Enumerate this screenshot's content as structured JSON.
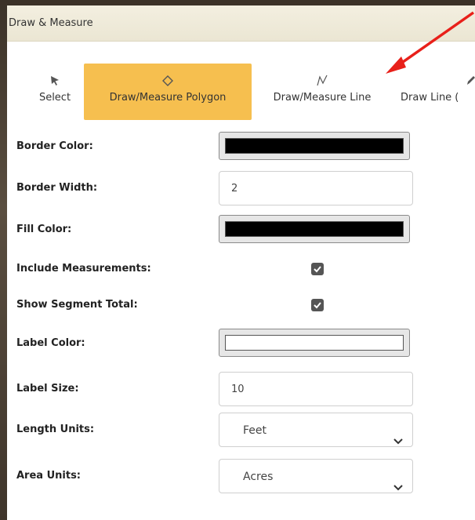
{
  "window": {
    "title": "Draw & Measure"
  },
  "toolbar": {
    "tools": [
      {
        "label": "Select",
        "icon": "select-arrow-icon"
      },
      {
        "label": "Draw/Measure Polygon",
        "icon": "polygon-icon",
        "active": true
      },
      {
        "label": "Draw/Measure Line",
        "icon": "polyline-icon"
      },
      {
        "label": "Draw Line (",
        "icon": "pencil-icon"
      }
    ]
  },
  "form": {
    "border_color": {
      "label": "Border Color:",
      "value": "#000000"
    },
    "border_width": {
      "label": "Border Width:",
      "value": "2"
    },
    "fill_color": {
      "label": "Fill Color:",
      "value": "#000000"
    },
    "include_measurements": {
      "label": "Include Measurements:",
      "checked": true
    },
    "show_segment_total": {
      "label": "Show Segment Total:",
      "checked": true
    },
    "label_color": {
      "label": "Label Color:",
      "value": "#ffffff"
    },
    "label_size": {
      "label": "Label Size:",
      "value": "10"
    },
    "length_units": {
      "label": "Length Units:",
      "value": "Feet"
    },
    "area_units": {
      "label": "Area Units:",
      "value": "Acres"
    }
  },
  "colors": {
    "accent": "#f6bf4f",
    "annotation_arrow": "#e8201a"
  }
}
